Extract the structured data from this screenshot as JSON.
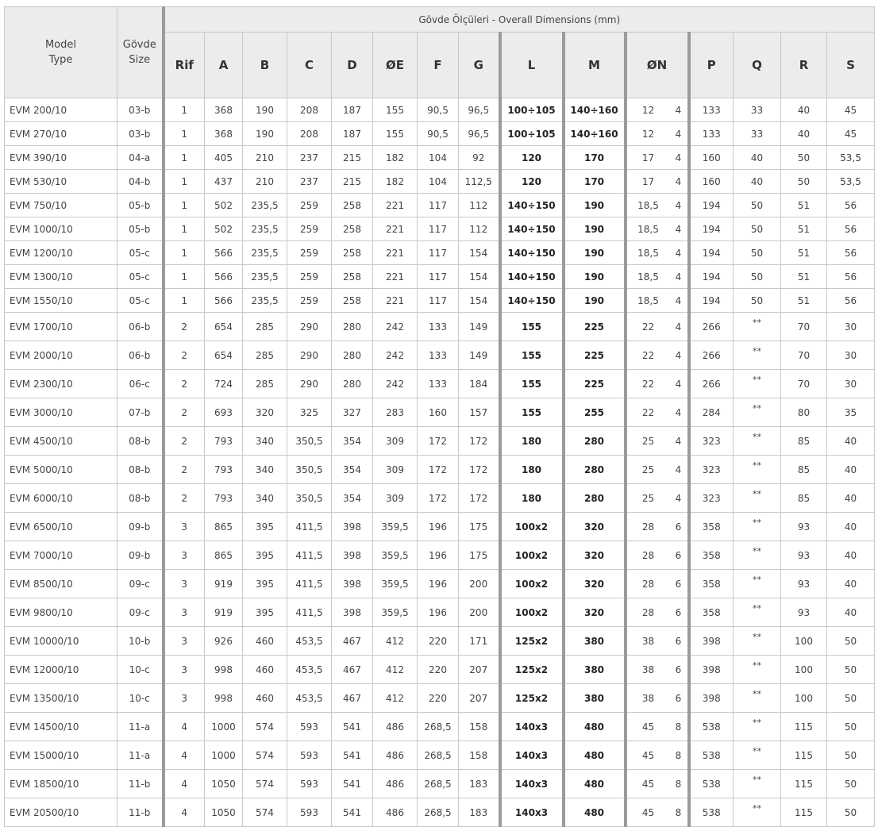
{
  "header": {
    "group_title": "Gövde Ölçüleri - Overall Dimensions (mm)",
    "model_label_line1": "Model",
    "model_label_line2": "Type",
    "size_label_line1": "Gövde",
    "size_label_line2": "Size",
    "columns": {
      "rif": "Rif",
      "a": "A",
      "b": "B",
      "c": "C",
      "d": "D",
      "oe": "ØE",
      "f": "F",
      "g": "G",
      "l": "L",
      "m": "M",
      "on": "ØN",
      "p": "P",
      "q": "Q",
      "r": "R",
      "s": "S"
    }
  },
  "rows": [
    [
      "EVM 200/10",
      "03-b",
      "1",
      "368",
      "190",
      "208",
      "187",
      "155",
      "90,5",
      "96,5",
      "100÷105",
      "140÷160",
      "12",
      "4",
      "133",
      "33",
      "40",
      "45"
    ],
    [
      "EVM 270/10",
      "03-b",
      "1",
      "368",
      "190",
      "208",
      "187",
      "155",
      "90,5",
      "96,5",
      "100÷105",
      "140÷160",
      "12",
      "4",
      "133",
      "33",
      "40",
      "45"
    ],
    [
      "EVM 390/10",
      "04-a",
      "1",
      "405",
      "210",
      "237",
      "215",
      "182",
      "104",
      "92",
      "120",
      "170",
      "17",
      "4",
      "160",
      "40",
      "50",
      "53,5"
    ],
    [
      "EVM 530/10",
      "04-b",
      "1",
      "437",
      "210",
      "237",
      "215",
      "182",
      "104",
      "112,5",
      "120",
      "170",
      "17",
      "4",
      "160",
      "40",
      "50",
      "53,5"
    ],
    [
      "EVM 750/10",
      "05-b",
      "1",
      "502",
      "235,5",
      "259",
      "258",
      "221",
      "117",
      "112",
      "140÷150",
      "190",
      "18,5",
      "4",
      "194",
      "50",
      "51",
      "56"
    ],
    [
      "EVM 1000/10",
      "05-b",
      "1",
      "502",
      "235,5",
      "259",
      "258",
      "221",
      "117",
      "112",
      "140÷150",
      "190",
      "18,5",
      "4",
      "194",
      "50",
      "51",
      "56"
    ],
    [
      "EVM 1200/10",
      "05-c",
      "1",
      "566",
      "235,5",
      "259",
      "258",
      "221",
      "117",
      "154",
      "140÷150",
      "190",
      "18,5",
      "4",
      "194",
      "50",
      "51",
      "56"
    ],
    [
      "EVM 1300/10",
      "05-c",
      "1",
      "566",
      "235,5",
      "259",
      "258",
      "221",
      "117",
      "154",
      "140÷150",
      "190",
      "18,5",
      "4",
      "194",
      "50",
      "51",
      "56"
    ],
    [
      "EVM 1550/10",
      "05-c",
      "1",
      "566",
      "235,5",
      "259",
      "258",
      "221",
      "117",
      "154",
      "140÷150",
      "190",
      "18,5",
      "4",
      "194",
      "50",
      "51",
      "56"
    ],
    [
      "EVM 1700/10",
      "06-b",
      "2",
      "654",
      "285",
      "290",
      "280",
      "242",
      "133",
      "149",
      "155",
      "225",
      "22",
      "4",
      "266",
      "**",
      "70",
      "30"
    ],
    [
      "EVM 2000/10",
      "06-b",
      "2",
      "654",
      "285",
      "290",
      "280",
      "242",
      "133",
      "149",
      "155",
      "225",
      "22",
      "4",
      "266",
      "**",
      "70",
      "30"
    ],
    [
      "EVM 2300/10",
      "06-c",
      "2",
      "724",
      "285",
      "290",
      "280",
      "242",
      "133",
      "184",
      "155",
      "225",
      "22",
      "4",
      "266",
      "**",
      "70",
      "30"
    ],
    [
      "EVM 3000/10",
      "07-b",
      "2",
      "693",
      "320",
      "325",
      "327",
      "283",
      "160",
      "157",
      "155",
      "255",
      "22",
      "4",
      "284",
      "**",
      "80",
      "35"
    ],
    [
      "EVM 4500/10",
      "08-b",
      "2",
      "793",
      "340",
      "350,5",
      "354",
      "309",
      "172",
      "172",
      "180",
      "280",
      "25",
      "4",
      "323",
      "**",
      "85",
      "40"
    ],
    [
      "EVM 5000/10",
      "08-b",
      "2",
      "793",
      "340",
      "350,5",
      "354",
      "309",
      "172",
      "172",
      "180",
      "280",
      "25",
      "4",
      "323",
      "**",
      "85",
      "40"
    ],
    [
      "EVM 6000/10",
      "08-b",
      "2",
      "793",
      "340",
      "350,5",
      "354",
      "309",
      "172",
      "172",
      "180",
      "280",
      "25",
      "4",
      "323",
      "**",
      "85",
      "40"
    ],
    [
      "EVM 6500/10",
      "09-b",
      "3",
      "865",
      "395",
      "411,5",
      "398",
      "359,5",
      "196",
      "175",
      "100x2",
      "320",
      "28",
      "6",
      "358",
      "**",
      "93",
      "40"
    ],
    [
      "EVM 7000/10",
      "09-b",
      "3",
      "865",
      "395",
      "411,5",
      "398",
      "359,5",
      "196",
      "175",
      "100x2",
      "320",
      "28",
      "6",
      "358",
      "**",
      "93",
      "40"
    ],
    [
      "EVM 8500/10",
      "09-c",
      "3",
      "919",
      "395",
      "411,5",
      "398",
      "359,5",
      "196",
      "200",
      "100x2",
      "320",
      "28",
      "6",
      "358",
      "**",
      "93",
      "40"
    ],
    [
      "EVM 9800/10",
      "09-c",
      "3",
      "919",
      "395",
      "411,5",
      "398",
      "359,5",
      "196",
      "200",
      "100x2",
      "320",
      "28",
      "6",
      "358",
      "**",
      "93",
      "40"
    ],
    [
      "EVM 10000/10",
      "10-b",
      "3",
      "926",
      "460",
      "453,5",
      "467",
      "412",
      "220",
      "171",
      "125x2",
      "380",
      "38",
      "6",
      "398",
      "**",
      "100",
      "50"
    ],
    [
      "EVM 12000/10",
      "10-c",
      "3",
      "998",
      "460",
      "453,5",
      "467",
      "412",
      "220",
      "207",
      "125x2",
      "380",
      "38",
      "6",
      "398",
      "**",
      "100",
      "50"
    ],
    [
      "EVM 13500/10",
      "10-c",
      "3",
      "998",
      "460",
      "453,5",
      "467",
      "412",
      "220",
      "207",
      "125x2",
      "380",
      "38",
      "6",
      "398",
      "**",
      "100",
      "50"
    ],
    [
      "EVM 14500/10",
      "11-a",
      "4",
      "1000",
      "574",
      "593",
      "541",
      "486",
      "268,5",
      "158",
      "140x3",
      "480",
      "45",
      "8",
      "538",
      "**",
      "115",
      "50"
    ],
    [
      "EVM 15000/10",
      "11-a",
      "4",
      "1000",
      "574",
      "593",
      "541",
      "486",
      "268,5",
      "158",
      "140x3",
      "480",
      "45",
      "8",
      "538",
      "**",
      "115",
      "50"
    ],
    [
      "EVM 18500/10",
      "11-b",
      "4",
      "1050",
      "574",
      "593",
      "541",
      "486",
      "268,5",
      "183",
      "140x3",
      "480",
      "45",
      "8",
      "538",
      "**",
      "115",
      "50"
    ],
    [
      "EVM 20500/10",
      "11-b",
      "4",
      "1050",
      "574",
      "593",
      "541",
      "486",
      "268,5",
      "183",
      "140x3",
      "480",
      "45",
      "8",
      "538",
      "**",
      "115",
      "50"
    ]
  ]
}
